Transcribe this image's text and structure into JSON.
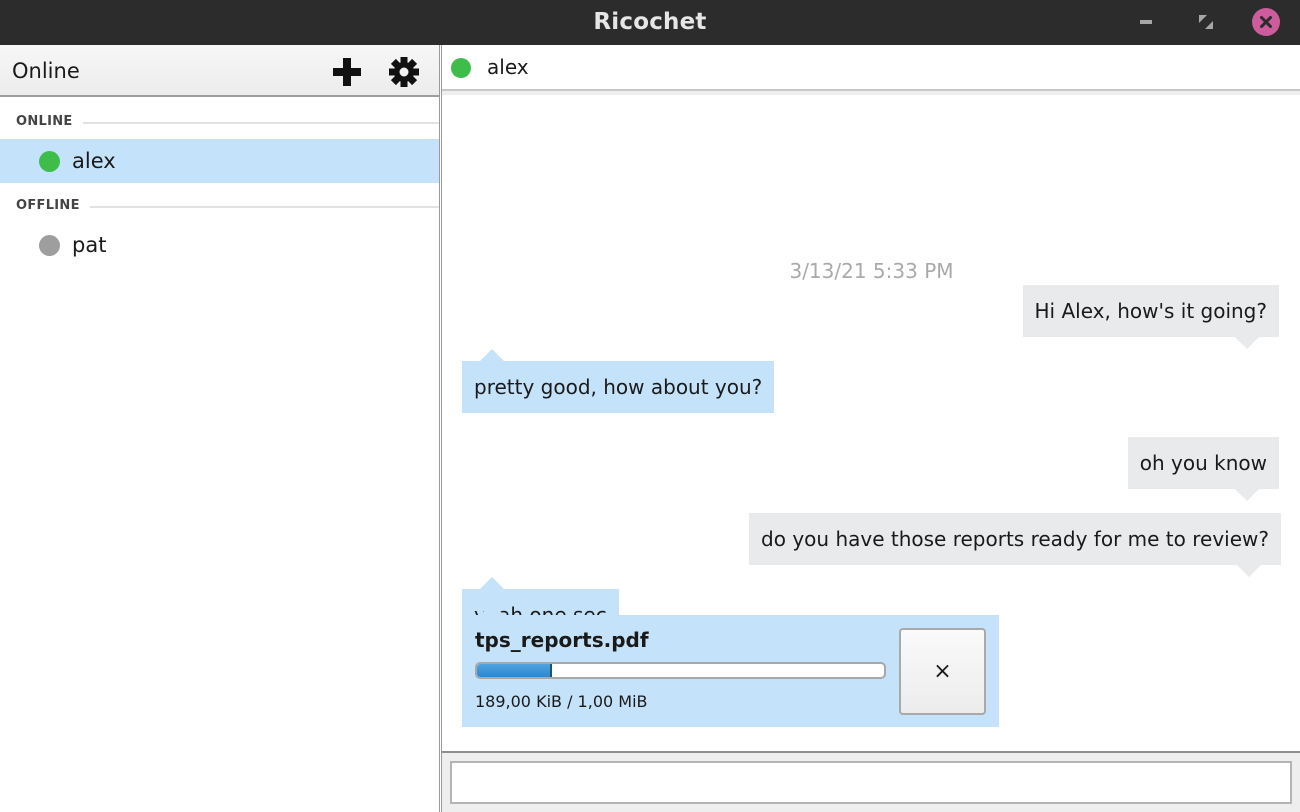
{
  "window": {
    "title": "Ricochet",
    "controls": [
      "minimize",
      "maximize",
      "close"
    ]
  },
  "sidebar": {
    "status_label": "Online",
    "add_contact_icon": "plus-icon",
    "settings_icon": "gear-icon",
    "sections": [
      {
        "title": "ONLINE",
        "contacts": [
          {
            "name": "alex",
            "status": "online",
            "status_color": "#3ebd4b",
            "selected": true
          }
        ]
      },
      {
        "title": "OFFLINE",
        "contacts": [
          {
            "name": "pat",
            "status": "offline",
            "status_color": "#9e9e9e",
            "selected": false
          }
        ]
      }
    ]
  },
  "chat": {
    "contact_name": "alex",
    "contact_status": "online",
    "timestamp": "3/13/21 5:33 PM",
    "messages": [
      {
        "direction": "outgoing",
        "text": "Hi Alex, how's it going?"
      },
      {
        "direction": "incoming",
        "text": "pretty good, how about you?"
      },
      {
        "direction": "outgoing",
        "text": "oh you know"
      },
      {
        "direction": "outgoing",
        "text": "do you have those reports ready for me to review?"
      },
      {
        "direction": "incoming",
        "text": "yeah one sec"
      }
    ],
    "file_transfer": {
      "direction": "incoming",
      "file_name": "tps_reports.pdf",
      "progress_fraction": 0.185,
      "size_text": "189,00 KiB / 1,00 MiB",
      "cancel_label": "×"
    },
    "composer": {
      "value": "",
      "placeholder": ""
    }
  },
  "colors": {
    "titlebar_bg": "#2c2c2c",
    "close_button": "#cc5c9c",
    "online": "#3ebd4b",
    "offline": "#9e9e9e",
    "selected_row": "#c4e3fb",
    "incoming_bubble": "#c4e3fb",
    "outgoing_bubble": "#e9eaec",
    "progress_fill": "#3a8fd4"
  }
}
